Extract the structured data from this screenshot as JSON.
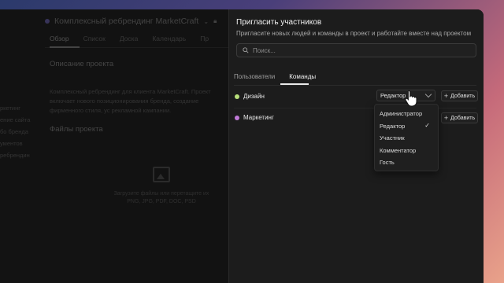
{
  "project": {
    "title": "Комплексный ребрендинг MarketCraft",
    "tabs": [
      "Обзор",
      "Список",
      "Доска",
      "Календарь",
      "Пр"
    ],
    "description_heading": "Описание проекта",
    "description_text": "Комплексный ребрендинг для клиента MarketCraft. Проект включает нового позиционирования бренда, создание фирменного стиля, ус рекламной кампании.",
    "sidebar_fragments": [
      "ркетинг",
      "ение сайта",
      "бо бренда",
      "ументов",
      "ребрендин"
    ],
    "files_heading": "Файлы проекта",
    "upload_text": "Загрузите файлы или перетащите их",
    "upload_formats": "PNG, JPG, PDF, DOC, PSD"
  },
  "invite": {
    "title": "Пригласить участников",
    "subtitle": "Пригласите новых людей и команды в проект и работайте вместе над проектом",
    "search_placeholder": "Поиск...",
    "tabs": [
      "Пользователи",
      "Команды"
    ],
    "active_tab": "Команды",
    "teams": [
      {
        "name": "Дизайн",
        "color": "#b8e07a",
        "role": "Редактор",
        "add_label": "Добавить"
      },
      {
        "name": "Маркетинг",
        "color": "#c07ad8",
        "add_label": "Добавить"
      }
    ],
    "role_menu": [
      "Администратор",
      "Редактор",
      "Участник",
      "Комментатор",
      "Гость"
    ],
    "role_selected": "Редактор"
  }
}
